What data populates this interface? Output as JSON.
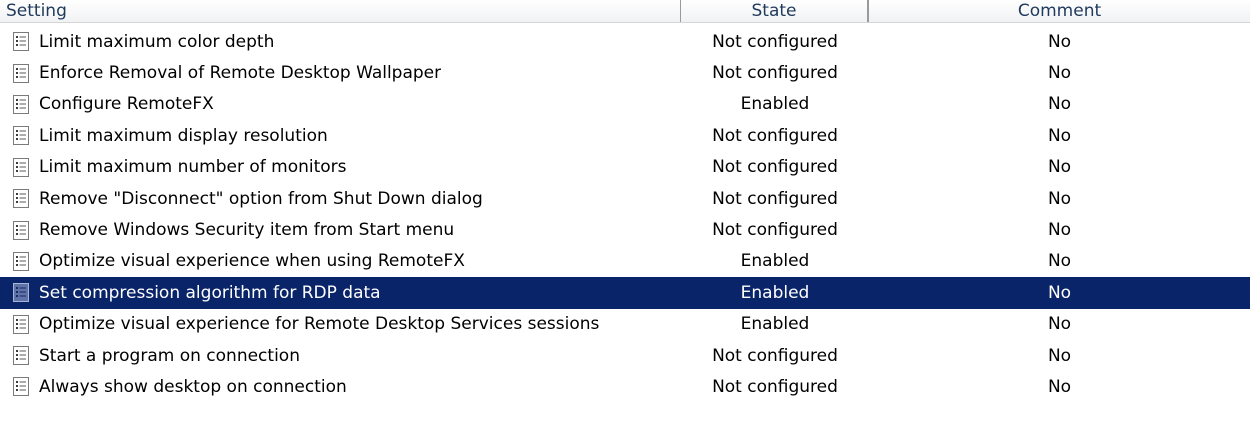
{
  "columns": {
    "setting": "Setting",
    "state": "State",
    "comment": "Comment"
  },
  "rows": [
    {
      "setting": "Limit maximum color depth",
      "state": "Not configured",
      "comment": "No",
      "icon": "policy-setting-icon"
    },
    {
      "setting": "Enforce Removal of Remote Desktop Wallpaper",
      "state": "Not configured",
      "comment": "No",
      "icon": "policy-setting-icon"
    },
    {
      "setting": "Configure RemoteFX",
      "state": "Enabled",
      "comment": "No",
      "icon": "policy-setting-icon"
    },
    {
      "setting": "Limit maximum display resolution",
      "state": "Not configured",
      "comment": "No",
      "icon": "policy-setting-icon"
    },
    {
      "setting": "Limit maximum number of monitors",
      "state": "Not configured",
      "comment": "No",
      "icon": "policy-setting-icon"
    },
    {
      "setting": "Remove \"Disconnect\" option from Shut Down dialog",
      "state": "Not configured",
      "comment": "No",
      "icon": "policy-setting-icon"
    },
    {
      "setting": "Remove Windows Security item from Start menu",
      "state": "Not configured",
      "comment": "No",
      "icon": "policy-setting-icon"
    },
    {
      "setting": "Optimize visual experience when using RemoteFX",
      "state": "Enabled",
      "comment": "No",
      "icon": "policy-setting-icon"
    },
    {
      "setting": "Set compression algorithm for RDP data",
      "state": "Enabled",
      "comment": "No",
      "icon": "policy-setting-icon",
      "selected": true
    },
    {
      "setting": "Optimize visual experience for Remote Desktop Services sessions",
      "state": "Enabled",
      "comment": "No",
      "icon": "policy-setting-icon"
    },
    {
      "setting": "Start a program on connection",
      "state": "Not configured",
      "comment": "No",
      "icon": "policy-setting-icon"
    },
    {
      "setting": "Always show desktop on connection",
      "state": "Not configured",
      "comment": "No",
      "icon": "policy-setting-icon"
    }
  ],
  "colors": {
    "selection_background": "#0a246a",
    "selection_text": "#ffffff",
    "header_text": "#1e395b"
  }
}
